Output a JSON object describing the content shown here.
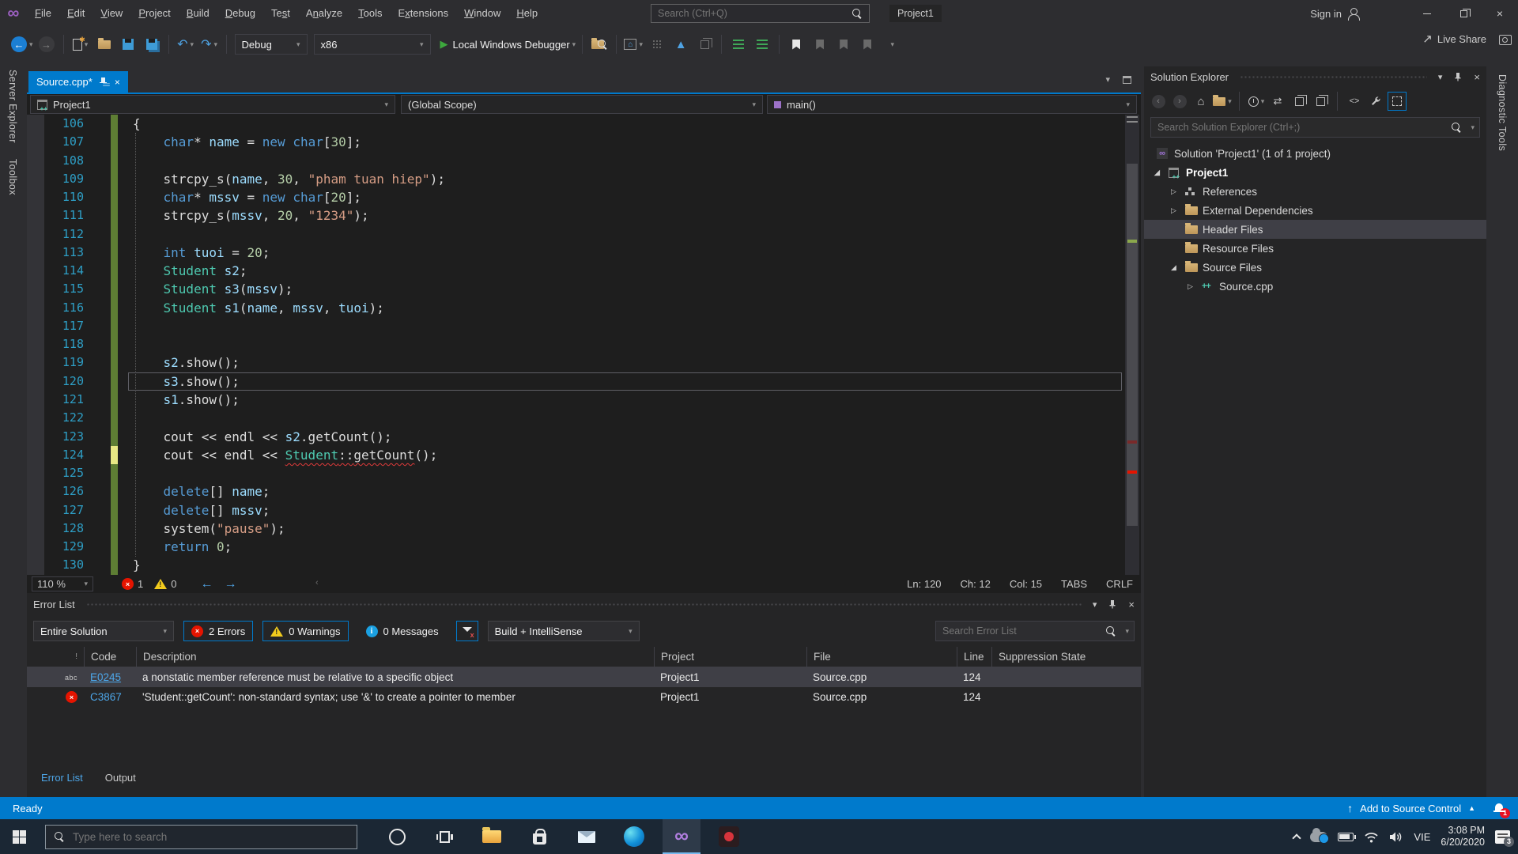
{
  "colors": {
    "accent": "#007ACC",
    "titlebar_bg": "#2D2D30",
    "editor_bg": "#1E1E1E",
    "panel_bg": "#252526",
    "selection_gray": "#3F3F46",
    "tab_active_blue": "#007ACC",
    "error_red": "#E51400",
    "warning_yellow": "#F2CB1D",
    "change_bar_green": "#5E7E34",
    "change_bar_yellow": "#E8E884",
    "line_number": "#2E9FC6",
    "taskbar_bg": "#1B2734",
    "vs_purple": "#9B5FC0"
  },
  "titlebar": {
    "menus": [
      {
        "label": "File",
        "u": 0
      },
      {
        "label": "Edit",
        "u": 0
      },
      {
        "label": "View",
        "u": 0
      },
      {
        "label": "Project",
        "u": 0
      },
      {
        "label": "Build",
        "u": 0
      },
      {
        "label": "Debug",
        "u": 0
      },
      {
        "label": "Test",
        "u": 2
      },
      {
        "label": "Analyze",
        "u": 1
      },
      {
        "label": "Tools",
        "u": 0
      },
      {
        "label": "Extensions",
        "u": 1
      },
      {
        "label": "Window",
        "u": 0
      },
      {
        "label": "Help",
        "u": 0
      }
    ],
    "search_placeholder": "Search (Ctrl+Q)",
    "project_badge": "Project1",
    "sign_in": "Sign in"
  },
  "toolbar": {
    "solution_config": "Debug",
    "solution_platform": "x86",
    "run_target": "Local Windows Debugger",
    "live_share": "Live Share"
  },
  "left_tabs": [
    "Server Explorer",
    "Toolbox"
  ],
  "right_tabs": [
    "Diagnostic Tools"
  ],
  "editor": {
    "tab_title": "Source.cpp*",
    "nav_project": "Project1",
    "nav_scope": "(Global Scope)",
    "nav_member": "main()",
    "current_line": 120,
    "status": {
      "zoom": "110 %",
      "errors": "1",
      "warnings": "0",
      "ln": "Ln: 120",
      "ch": "Ch: 12",
      "col": "Col: 15",
      "tabs": "TABS",
      "eol": "CRLF"
    },
    "code_lines": [
      {
        "n": 106,
        "bar": "g",
        "tokens": [
          [
            "{",
            "pl"
          ]
        ]
      },
      {
        "n": 107,
        "bar": "g",
        "tokens": [
          [
            "    ",
            "pl"
          ],
          [
            "char",
            "kw"
          ],
          [
            "* ",
            "pl"
          ],
          [
            "name",
            "va"
          ],
          [
            " = ",
            "pl"
          ],
          [
            "new",
            "kw"
          ],
          [
            " ",
            "pl"
          ],
          [
            "char",
            "kw"
          ],
          [
            "[",
            "pl"
          ],
          [
            "30",
            "nu"
          ],
          [
            "];",
            "pl"
          ]
        ]
      },
      {
        "n": 108,
        "bar": "g",
        "tokens": []
      },
      {
        "n": 109,
        "bar": "g",
        "tokens": [
          [
            "    ",
            "pl"
          ],
          [
            "strcpy_s(",
            "pl"
          ],
          [
            "name",
            "va"
          ],
          [
            ", ",
            "pl"
          ],
          [
            "30",
            "nu"
          ],
          [
            ", ",
            "pl"
          ],
          [
            "\"pham tuan hiep\"",
            "st"
          ],
          [
            ");",
            "pl"
          ]
        ]
      },
      {
        "n": 110,
        "bar": "g",
        "tokens": [
          [
            "    ",
            "pl"
          ],
          [
            "char",
            "kw"
          ],
          [
            "* ",
            "pl"
          ],
          [
            "mssv",
            "va"
          ],
          [
            " = ",
            "pl"
          ],
          [
            "new",
            "kw"
          ],
          [
            " ",
            "pl"
          ],
          [
            "char",
            "kw"
          ],
          [
            "[",
            "pl"
          ],
          [
            "20",
            "nu"
          ],
          [
            "];",
            "pl"
          ]
        ]
      },
      {
        "n": 111,
        "bar": "g",
        "tokens": [
          [
            "    ",
            "pl"
          ],
          [
            "strcpy_s(",
            "pl"
          ],
          [
            "mssv",
            "va"
          ],
          [
            ", ",
            "pl"
          ],
          [
            "20",
            "nu"
          ],
          [
            ", ",
            "pl"
          ],
          [
            "\"1234\"",
            "st"
          ],
          [
            ");",
            "pl"
          ]
        ]
      },
      {
        "n": 112,
        "bar": "g",
        "tokens": []
      },
      {
        "n": 113,
        "bar": "g",
        "tokens": [
          [
            "    ",
            "pl"
          ],
          [
            "int",
            "kw"
          ],
          [
            " ",
            "pl"
          ],
          [
            "tuoi",
            "va"
          ],
          [
            " = ",
            "pl"
          ],
          [
            "20",
            "nu"
          ],
          [
            ";",
            "pl"
          ]
        ]
      },
      {
        "n": 114,
        "bar": "g",
        "tokens": [
          [
            "    ",
            "pl"
          ],
          [
            "Student",
            "ty"
          ],
          [
            " ",
            "pl"
          ],
          [
            "s2",
            "va"
          ],
          [
            ";",
            "pl"
          ]
        ]
      },
      {
        "n": 115,
        "bar": "g",
        "tokens": [
          [
            "    ",
            "pl"
          ],
          [
            "Student",
            "ty"
          ],
          [
            " ",
            "pl"
          ],
          [
            "s3",
            "va"
          ],
          [
            "(",
            "pl"
          ],
          [
            "mssv",
            "va"
          ],
          [
            ");",
            "pl"
          ]
        ]
      },
      {
        "n": 116,
        "bar": "g",
        "tokens": [
          [
            "    ",
            "pl"
          ],
          [
            "Student",
            "ty"
          ],
          [
            " ",
            "pl"
          ],
          [
            "s1",
            "va"
          ],
          [
            "(",
            "pl"
          ],
          [
            "name",
            "va"
          ],
          [
            ", ",
            "pl"
          ],
          [
            "mssv",
            "va"
          ],
          [
            ", ",
            "pl"
          ],
          [
            "tuoi",
            "va"
          ],
          [
            ");",
            "pl"
          ]
        ]
      },
      {
        "n": 117,
        "bar": "g",
        "tokens": []
      },
      {
        "n": 118,
        "bar": "g",
        "tokens": []
      },
      {
        "n": 119,
        "bar": "g",
        "tokens": [
          [
            "    ",
            "pl"
          ],
          [
            "s2",
            "va"
          ],
          [
            ".show();",
            "pl"
          ]
        ]
      },
      {
        "n": 120,
        "bar": "g",
        "tokens": [
          [
            "    ",
            "pl"
          ],
          [
            "s3",
            "va"
          ],
          [
            ".show();",
            "pl"
          ]
        ]
      },
      {
        "n": 121,
        "bar": "g",
        "tokens": [
          [
            "    ",
            "pl"
          ],
          [
            "s1",
            "va"
          ],
          [
            ".show();",
            "pl"
          ]
        ]
      },
      {
        "n": 122,
        "bar": "g",
        "tokens": []
      },
      {
        "n": 123,
        "bar": "g",
        "tokens": [
          [
            "    ",
            "pl"
          ],
          [
            "cout",
            "pl"
          ],
          [
            " << ",
            "pl"
          ],
          [
            "endl",
            "pl"
          ],
          [
            " << ",
            "pl"
          ],
          [
            "s2",
            "va"
          ],
          [
            ".getCount();",
            "pl"
          ]
        ]
      },
      {
        "n": 124,
        "bar": "y",
        "tokens": [
          [
            "    ",
            "pl"
          ],
          [
            "cout",
            "pl"
          ],
          [
            " << ",
            "pl"
          ],
          [
            "endl",
            "pl"
          ],
          [
            " << ",
            "pl"
          ],
          [
            "Student",
            "ty er"
          ],
          [
            "::",
            "pl er"
          ],
          [
            "getCount",
            "pl er"
          ],
          [
            "();",
            "pl"
          ]
        ]
      },
      {
        "n": 125,
        "bar": "g",
        "tokens": []
      },
      {
        "n": 126,
        "bar": "g",
        "tokens": [
          [
            "    ",
            "pl"
          ],
          [
            "delete",
            "kw"
          ],
          [
            "[] ",
            "pl"
          ],
          [
            "name",
            "va"
          ],
          [
            ";",
            "pl"
          ]
        ]
      },
      {
        "n": 127,
        "bar": "g",
        "tokens": [
          [
            "    ",
            "pl"
          ],
          [
            "delete",
            "kw"
          ],
          [
            "[] ",
            "pl"
          ],
          [
            "mssv",
            "va"
          ],
          [
            ";",
            "pl"
          ]
        ]
      },
      {
        "n": 128,
        "bar": "g",
        "tokens": [
          [
            "    ",
            "pl"
          ],
          [
            "system(",
            "pl"
          ],
          [
            "\"pause\"",
            "st"
          ],
          [
            ");",
            "pl"
          ]
        ]
      },
      {
        "n": 129,
        "bar": "g",
        "tokens": [
          [
            "    ",
            "pl"
          ],
          [
            "return",
            "kw"
          ],
          [
            " ",
            "pl"
          ],
          [
            "0",
            "nu"
          ],
          [
            ";",
            "pl"
          ]
        ]
      },
      {
        "n": 130,
        "bar": "g",
        "tokens": [
          [
            "}",
            "pl"
          ]
        ]
      }
    ]
  },
  "error_list": {
    "title": "Error List",
    "filter_scope": "Entire Solution",
    "errors_label": "2 Errors",
    "warnings_label": "0 Warnings",
    "messages_label": "0 Messages",
    "source_filter": "Build + IntelliSense",
    "search_placeholder": "Search Error List",
    "columns": [
      "Code",
      "Description",
      "Project",
      "File",
      "Line",
      "Suppression State"
    ],
    "rows": [
      {
        "icon": "intellisense",
        "code": "E0245",
        "link": true,
        "description": "a nonstatic member reference must be relative to a specific object",
        "project": "Project1",
        "file": "Source.cpp",
        "line": "124",
        "selected": true
      },
      {
        "icon": "error",
        "code": "C3867",
        "link": false,
        "description": "'Student::getCount': non-standard syntax; use '&' to create a pointer to member",
        "project": "Project1",
        "file": "Source.cpp",
        "line": "124",
        "selected": false
      }
    ],
    "bottom_tabs": [
      {
        "label": "Error List",
        "active": true
      },
      {
        "label": "Output",
        "active": false
      }
    ]
  },
  "solution_explorer": {
    "title": "Solution Explorer",
    "search_placeholder": "Search Solution Explorer (Ctrl+;)",
    "items": [
      {
        "label": "Solution 'Project1' (1 of 1 project)",
        "level": 0,
        "arrow": "none",
        "icon": "solution"
      },
      {
        "label": "Project1",
        "level": 1,
        "arrow": "expanded",
        "icon": "project",
        "bold": true
      },
      {
        "label": "References",
        "level": 2,
        "arrow": "collapsed",
        "icon": "refs"
      },
      {
        "label": "External Dependencies",
        "level": 2,
        "arrow": "collapsed",
        "ic on": "folder",
        "icon": "folder"
      },
      {
        "label": "Header Files",
        "level": 2,
        "arrow": "none",
        "icon": "folder",
        "selected": true
      },
      {
        "label": "Resource Files",
        "level": 2,
        "arrow": "none",
        "icon": "folder"
      },
      {
        "label": "Source Files",
        "level": 2,
        "arrow": "expanded",
        "icon": "folder"
      },
      {
        "label": "Source.cpp",
        "level": 3,
        "arrow": "collapsed",
        "icon": "cpp"
      }
    ]
  },
  "statusbar": {
    "ready": "Ready",
    "source_control": "Add to Source Control",
    "notifications_badge": "1"
  },
  "taskbar": {
    "search_placeholder": "Type here to search",
    "language": "VIE",
    "time": "3:08 PM",
    "date": "6/20/2020",
    "notification_badge": "3"
  }
}
